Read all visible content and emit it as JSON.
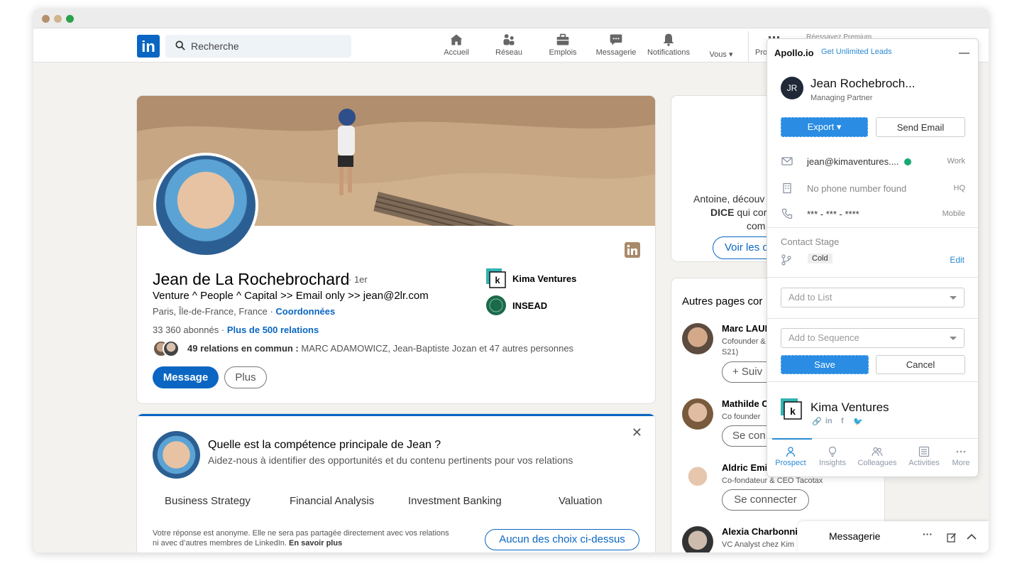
{
  "navbar": {
    "logo_text": "in",
    "search_placeholder": "Recherche",
    "items": [
      {
        "label": "Accueil",
        "icon": "home-icon"
      },
      {
        "label": "Réseau",
        "icon": "network-icon"
      },
      {
        "label": "Emplois",
        "icon": "briefcase-icon"
      },
      {
        "label": "Messagerie",
        "icon": "messaging-icon"
      },
      {
        "label": "Notifications",
        "icon": "bell-icon"
      },
      {
        "label": "Vous ▾",
        "icon": "me-icon"
      }
    ],
    "partial_label": "Pro",
    "partial_premium": "Réessayez Premium"
  },
  "profile": {
    "name": "Jean de La Rochebrochard",
    "degree": "· 1er",
    "headline": "Venture ^ People ^ Capital >> Email only >> jean@2lr.com",
    "location": "Paris, Île-de-France, France",
    "contact_link": "Coordonnées",
    "followers": "33 360 abonnés",
    "connections": "Plus de 500 relations",
    "mutual_bold": "49 relations en commun :",
    "mutual_rest": "MARC ADAMOWICZ, Jean-Baptiste Jozan et 47 autres personnes",
    "message_button": "Message",
    "more_button": "Plus",
    "orgs": [
      {
        "name": "Kima Ventures",
        "logo": "kima-logo"
      },
      {
        "name": "INSEAD",
        "logo": "insead-logo"
      }
    ]
  },
  "skills_card": {
    "question": "Quelle est la compétence principale de Jean ?",
    "subtitle": "Aidez-nous à identifier des opportunités et du contenu pertinents pour vos relations",
    "skills": [
      "Business Strategy",
      "Financial Analysis",
      "Investment Banking",
      "Valuation"
    ],
    "anon_line1": "Votre réponse est anonyme. Elle ne sera pas partagée directement avec vos relations",
    "anon_line2_prefix": "ni avec d’autres membres de LinkedIn.",
    "anon_learn_more": "En savoir plus",
    "none_button": "Aucun des choix ci-dessus"
  },
  "right_top_card": {
    "line1": "Antoine, découv",
    "line2_bold": "DICE",
    "line2_rest": "qui cor",
    "line3": "com",
    "button": "Voir les o"
  },
  "other_pages": {
    "title": "Autres pages cor",
    "people": [
      {
        "name": "Marc LAUI",
        "desc1": "Cofounder &",
        "desc2": "S21)",
        "button": "+ Suiv"
      },
      {
        "name": "Mathilde C",
        "desc1": "Co founder",
        "desc2": "",
        "button": "Se con"
      },
      {
        "name": "Aldric Emi",
        "desc1": "Co-fondateur & CEO Tacotax",
        "desc2": "",
        "button": "Se connecter"
      },
      {
        "name": "Alexia Charbonni",
        "desc1": "VC Analyst chez Kim",
        "desc2": "",
        "button": ""
      }
    ]
  },
  "apollo": {
    "logo": "Apollo.io",
    "upgrade_link": "Get Unlimited Leads",
    "initials": "JR",
    "name": "Jean Rochebroch...",
    "role": "Managing Partner",
    "export_button": "Export",
    "send_email_button": "Send Email",
    "contacts": [
      {
        "icon": "mail-icon",
        "value": "jean@kimaventures....",
        "tag": "Work",
        "muted": false,
        "verified": true
      },
      {
        "icon": "building-icon",
        "value": "No phone number found",
        "tag": "HQ",
        "muted": true,
        "verified": false
      },
      {
        "icon": "phone-icon",
        "value": "*** - *** - ****",
        "tag": "Mobile",
        "muted": false,
        "verified": false
      }
    ],
    "stage_label": "Contact Stage",
    "stage_value": "Cold",
    "edit_link": "Edit",
    "add_to_list_placeholder": "Add to List",
    "add_to_sequence_placeholder": "Add to Sequence",
    "save_button": "Save",
    "cancel_button": "Cancel",
    "company": "Kima Ventures",
    "tabs": [
      {
        "label": "Prospect",
        "icon": "person-icon",
        "active": true
      },
      {
        "label": "Insights",
        "icon": "lightbulb-icon",
        "active": false
      },
      {
        "label": "Colleagues",
        "icon": "people-icon",
        "active": false
      },
      {
        "label": "Activities",
        "icon": "activities-icon",
        "active": false
      },
      {
        "label": "More",
        "icon": "more-icon",
        "active": false
      }
    ],
    "colors": {
      "accent": "#2a8ce2",
      "link": "#2a8ad3"
    }
  },
  "messaging_bar": {
    "title": "Messagerie",
    "more": "···"
  },
  "colors": {
    "linkedin_blue": "#0a66c2",
    "page_bg": "#f3f2ef"
  }
}
